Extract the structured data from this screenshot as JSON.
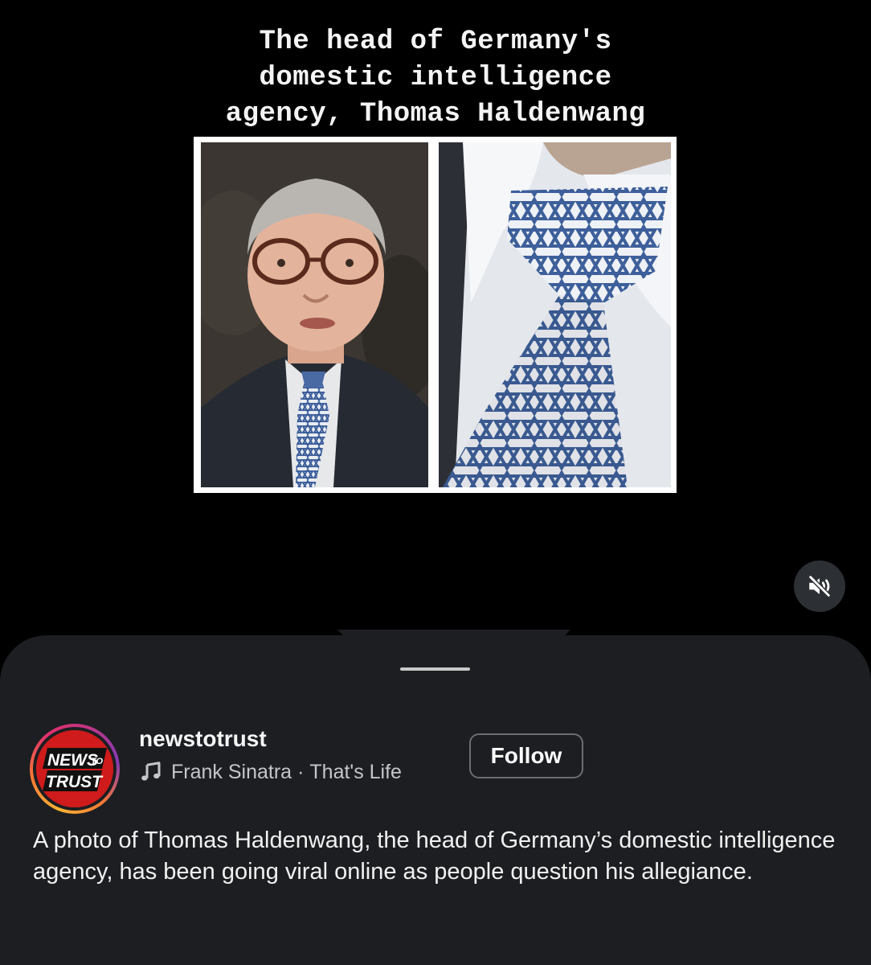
{
  "post": {
    "caption_line1": "The head of Germany's",
    "caption_line2": "domestic intelligence",
    "caption_line3": "agency, Thomas Haldenwang",
    "image_left": "portrait-photo",
    "image_right": "tie-closeup-photo",
    "mute_icon": "muted-speaker-icon"
  },
  "sheet": {
    "avatar_logo_line1": "NEWS",
    "avatar_logo_small": "TO",
    "avatar_logo_line2": "TRUST",
    "username": "newstotrust",
    "audio_icon": "music-note-icon",
    "audio_artist": "Frank Sinatra",
    "audio_separator": "·",
    "audio_track": "That's Life",
    "follow_label": "Follow",
    "description": "A photo of Thomas Haldenwang, the head of Germany’s domestic intelligence agency, has been going viral online as people question his allegiance."
  },
  "colors": {
    "background": "#000000",
    "sheet": "#1c1e21",
    "logo_red": "#cf1b1b",
    "tie_blue": "#3d5f9a"
  }
}
